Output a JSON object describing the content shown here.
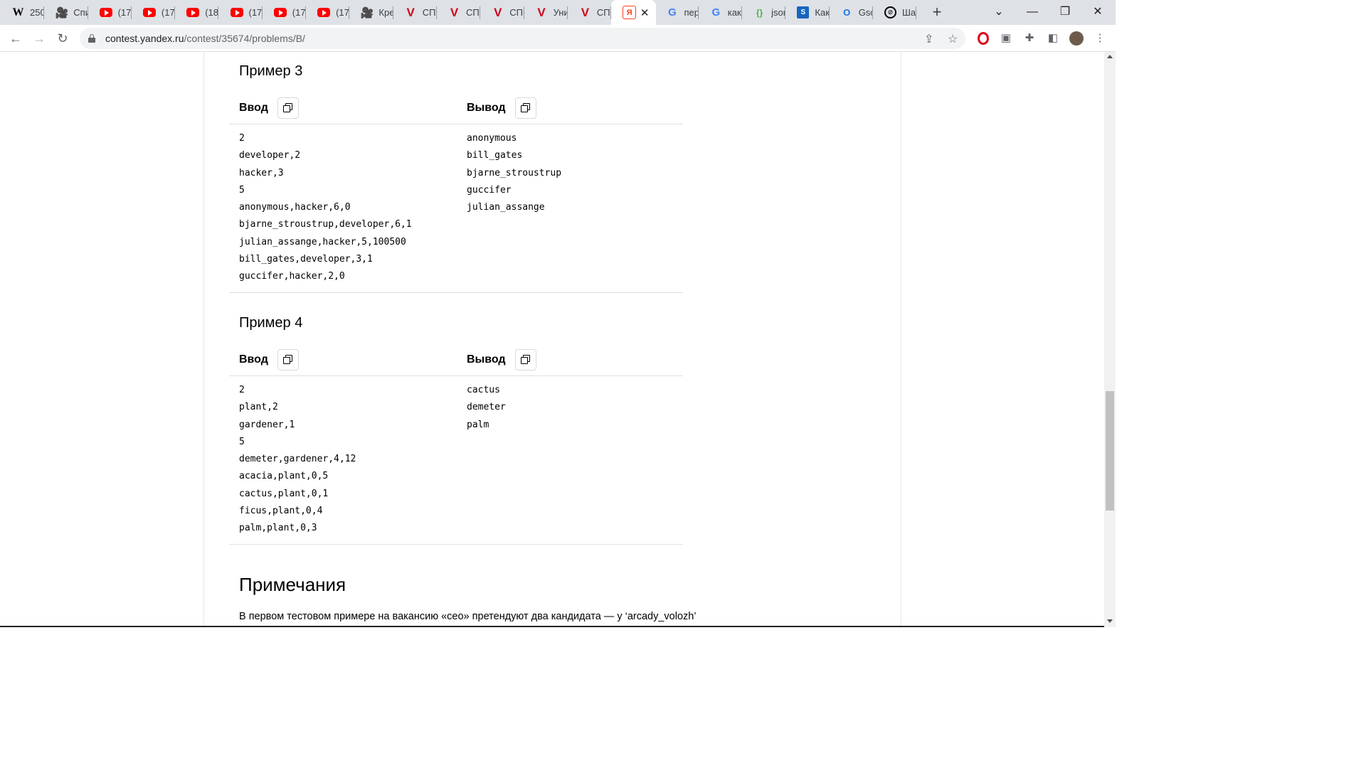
{
  "browser": {
    "tabs": [
      {
        "icon": "wikipedia-icon",
        "glyph": "W",
        "title": "250"
      },
      {
        "icon": "video-camera-icon",
        "glyph": "🎥",
        "title": "Спи"
      },
      {
        "icon": "youtube-icon",
        "glyph": "",
        "title": "(17"
      },
      {
        "icon": "youtube-icon",
        "glyph": "",
        "title": "(17"
      },
      {
        "icon": "youtube-icon",
        "glyph": "",
        "title": "(18"
      },
      {
        "icon": "youtube-icon",
        "glyph": "",
        "title": "(17"
      },
      {
        "icon": "youtube-icon",
        "glyph": "",
        "title": "(17"
      },
      {
        "icon": "youtube-icon",
        "glyph": "",
        "title": "(17"
      },
      {
        "icon": "video-camera-icon",
        "glyph": "🎥",
        "title": "Кре"
      },
      {
        "icon": "v-logo-icon",
        "glyph": "V",
        "title": "СПб"
      },
      {
        "icon": "v-logo-icon",
        "glyph": "V",
        "title": "СПб"
      },
      {
        "icon": "v-logo-icon",
        "glyph": "V",
        "title": "СПб"
      },
      {
        "icon": "v-logo-icon",
        "glyph": "V",
        "title": "Уни"
      },
      {
        "icon": "v-logo-icon",
        "glyph": "V",
        "title": "СПб"
      },
      {
        "icon": "yandex-icon",
        "glyph": "Я",
        "title": "",
        "active": true
      },
      {
        "icon": "google-icon",
        "glyph": "G",
        "title": "пер"
      },
      {
        "icon": "google-icon",
        "glyph": "G",
        "title": "как"
      },
      {
        "icon": "json-icon",
        "glyph": "{}",
        "title": "json"
      },
      {
        "icon": "stackoverflow-icon",
        "glyph": "S",
        "title": "Как"
      },
      {
        "icon": "opera-o-icon",
        "glyph": "O",
        "title": "Gsc"
      },
      {
        "icon": "stop-icon",
        "glyph": "⊘",
        "title": "Ша"
      }
    ],
    "new_tab_glyph": "+",
    "url_host": "contest.yandex.ru",
    "url_path": "/contest/35674/problems/B/"
  },
  "examples": [
    {
      "title": "Пример 3",
      "input_label": "Ввод",
      "output_label": "Вывод",
      "input": "2\ndeveloper,2\nhacker,3\n5\nanonymous,hacker,6,0\nbjarne_stroustrup,developer,6,1\njulian_assange,hacker,5,100500\nbill_gates,developer,3,1\nguccifer,hacker,2,0",
      "output": "anonymous\nbill_gates\nbjarne_stroustrup\nguccifer\njulian_assange"
    },
    {
      "title": "Пример 4",
      "input_label": "Ввод",
      "output_label": "Вывод",
      "input": "2\nplant,2\ngardener,1\n5\ndemeter,gardener,4,12\nacacia,plant,0,5\ncactus,plant,0,1\nficus,plant,0,4\npalm,plant,0,3",
      "output": "cactus\ndemeter\npalm"
    }
  ],
  "notes": {
    "title": "Примечания",
    "text": "В первом тестовом примере на вакансию «ceo» претендуют два кандидата — у ‘arcady_volozh’"
  }
}
